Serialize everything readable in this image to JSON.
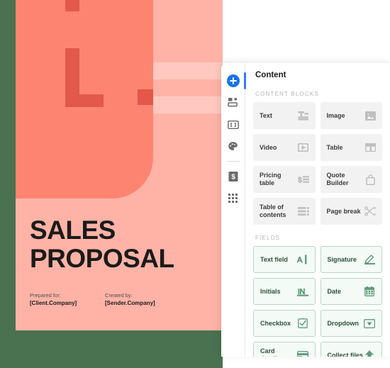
{
  "workspace": {
    "background_color": "#4a7150",
    "canvas_color": "#ffffff"
  },
  "document_preview": {
    "name": "sales-proposal-cover",
    "title_line1": "SALES",
    "title_line2": "PROPOSAL",
    "prepared_for_label": "Prepared for:",
    "prepared_for_value": "[Client.Company]",
    "created_by_label": "Created by:",
    "created_by_value": "[Sender.Company]",
    "colors": {
      "page_background": "#ffb3a7",
      "art_panel": "#fd8471",
      "accent": "#e2584a",
      "stripe_light": "#ffc9bf",
      "title_text": "#1b1b1b"
    }
  },
  "panel": {
    "header_title": "Content",
    "accent_color": "#2f7ef7",
    "rail": [
      {
        "name": "add-block-icon",
        "label": "Add block",
        "active": true
      },
      {
        "name": "layout-icon",
        "label": "Layout",
        "active": false
      },
      {
        "name": "variables-icon",
        "label": "Variables",
        "active": false
      },
      {
        "name": "theme-palette-icon",
        "label": "Theme",
        "active": false
      },
      {
        "name": "pricing-dollar-icon",
        "label": "Pricing",
        "active": false
      },
      {
        "name": "apps-grid-icon",
        "label": "Apps",
        "active": false
      }
    ],
    "sections": [
      {
        "key": "content_blocks",
        "label": "CONTENT BLOCKS",
        "style": "block",
        "items": [
          {
            "label": "Text",
            "icon": "text-icon"
          },
          {
            "label": "Image",
            "icon": "image-icon"
          },
          {
            "label": "Video",
            "icon": "video-icon"
          },
          {
            "label": "Table",
            "icon": "table-icon"
          },
          {
            "label": "Pricing table",
            "icon": "pricing-table-icon"
          },
          {
            "label": "Quote Builder",
            "icon": "quote-builder-bag-icon"
          },
          {
            "label": "Table of contents",
            "icon": "table-of-contents-icon"
          },
          {
            "label": "Page break",
            "icon": "page-break-scissors-icon"
          }
        ]
      },
      {
        "key": "fields",
        "label": "FIELDS",
        "style": "field",
        "items": [
          {
            "label": "Text field",
            "icon": "text-field-icon"
          },
          {
            "label": "Signature",
            "icon": "signature-pen-icon"
          },
          {
            "label": "Initials",
            "icon": "initials-icon"
          },
          {
            "label": "Date",
            "icon": "calendar-icon"
          },
          {
            "label": "Checkbox",
            "icon": "checkbox-icon"
          },
          {
            "label": "Dropdown",
            "icon": "dropdown-icon"
          },
          {
            "label": "Card details",
            "icon": "credit-card-icon"
          },
          {
            "label": "Collect files",
            "icon": "upload-arrow-icon"
          }
        ]
      }
    ],
    "colors": {
      "block_card_bg": "#f2f2f2",
      "block_icon": "#bfbfbf",
      "field_card_bg": "#f4faf6",
      "field_border": "#b7d7c3",
      "field_icon": "#5f9d7b",
      "section_label": "#b6b6b6"
    }
  }
}
